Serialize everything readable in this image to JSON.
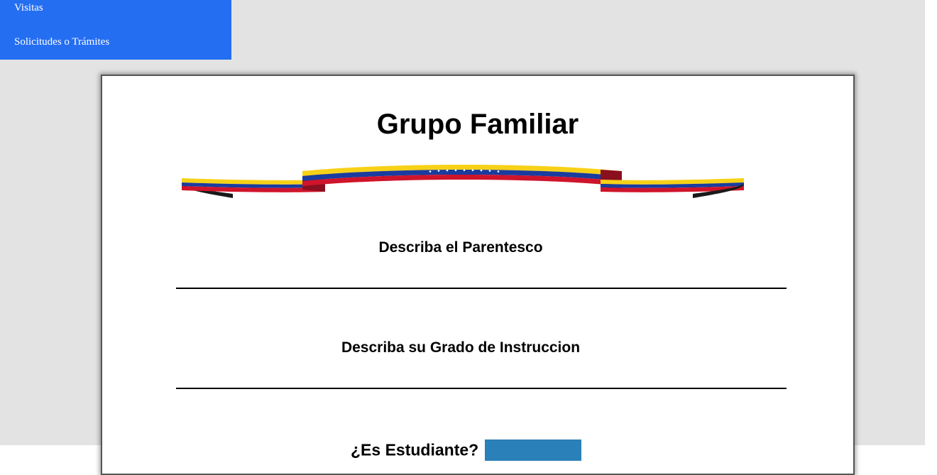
{
  "nav": {
    "items": [
      {
        "label": "Visitas"
      },
      {
        "label": "Solicitudes o Trámites"
      }
    ],
    "color": "#246ef2"
  },
  "form": {
    "title": "Grupo Familiar",
    "ribbon_icon": "venezuela-flag-ribbon-icon",
    "parentesco_label": "Describa el Parentesco",
    "grado_label": "Describa su Grado de Instruccion",
    "estudiante_label": "¿Es Estudiante?",
    "estudiante_select_color": "#2a80b9"
  },
  "colors": {
    "page_background": "#e3e3e3",
    "card_background": "#ffffff",
    "flag_yellow": "#f7d117",
    "flag_blue": "#1a3c9e",
    "flag_red": "#cf142b"
  }
}
